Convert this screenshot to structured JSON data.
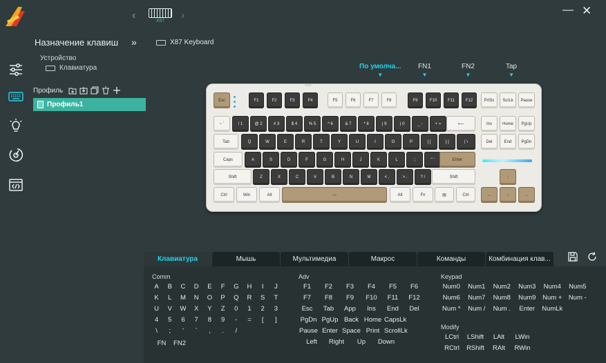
{
  "sidebar": {
    "title": "Назначение клавиш",
    "device_label": "Устройство",
    "device_item": "Клавиатура",
    "profile_label": "Профиль",
    "profile_item": "Профиль1"
  },
  "header": {
    "device_caption": "X87",
    "device_name": "X87 Keyboard"
  },
  "layers": [
    "По умолча...",
    "FN1",
    "FN2",
    "Tap"
  ],
  "colors": {
    "accent": "#3bb3a0",
    "highlight": "#22d3f0",
    "background": "#2f3b3c"
  },
  "keys": {
    "esc": "Esc",
    "f1": "F1",
    "f2": "F2",
    "f3": "F3",
    "f4": "F4",
    "f5": "F5",
    "f6": "F6",
    "f7": "F7",
    "f8": "F8",
    "f9": "F9",
    "f10": "F10",
    "f11": "F11",
    "f12": "F12",
    "prtsc": "PrtSc",
    "scrlk": "ScrLk",
    "pause": "Pause",
    "grave": "~ `",
    "n1": "! 1",
    "n2": "@ 2",
    "n3": "# 3",
    "n4": "$ 4",
    "n5": "% 5",
    "n6": "^ 6",
    "n7": "& 7",
    "n8": "* 8",
    "n9": "( 9",
    "n0": ") 0",
    "minus": "_ -",
    "equal": "+ =",
    "backspace": "⟵",
    "ins": "Ins",
    "home": "Home",
    "pgup": "PgUp",
    "tab": "Tab",
    "q": "Q",
    "w": "W",
    "e": "E",
    "r": "R",
    "t": "T",
    "y": "Y",
    "u": "U",
    "i": "I",
    "o": "O",
    "p": "P",
    "lbr": "{ [",
    "rbr": "} ]",
    "bslash": "| \\",
    "del": "Del",
    "end": "End",
    "pgdn": "PgDn",
    "caps": "Caps",
    "a": "A",
    "s": "S",
    "d": "D",
    "f": "F",
    "g": "G",
    "h": "H",
    "j": "J",
    "k": "K",
    "l": "L",
    "semi": ": ;",
    "quote": "\" '",
    "enter": "Enter",
    "lshift": "Shift",
    "z": "Z",
    "x": "X",
    "c": "C",
    "v": "V",
    "b": "B",
    "n": "N",
    "m": "M",
    "comma": "< ,",
    "period": "> .",
    "slash": "? /",
    "rshift": "Shift",
    "up": "↑",
    "lctrl": "Ctrl",
    "win": "Win",
    "lalt": "Alt",
    "space": "⎯⎯",
    "ralt": "Alt",
    "fn": "Fn",
    "menu": "▤",
    "rctrl": "Ctrl",
    "left": "←",
    "down": "↓",
    "right": "→"
  },
  "tabs": [
    "Клавиатура",
    "Мышь",
    "Мультимедиа",
    "Макрос",
    "Команды",
    "Комбинация клав..."
  ],
  "groups": {
    "comm_title": "Comm",
    "comm_rows": [
      [
        "A",
        "B",
        "C",
        "D",
        "E",
        "F",
        "G",
        "H",
        "I",
        "J"
      ],
      [
        "K",
        "L",
        "M",
        "N",
        "O",
        "P",
        "Q",
        "R",
        "S",
        "T"
      ],
      [
        "U",
        "V",
        "W",
        "X",
        "Y",
        "Z",
        "0",
        "1",
        "2",
        "3"
      ],
      [
        "4",
        "5",
        "6",
        "7",
        "8",
        "9",
        "-",
        "=",
        "[",
        "]"
      ],
      [
        "\\",
        ";",
        "'",
        "`",
        ",",
        ".",
        "/"
      ],
      [
        "FN",
        "FN2"
      ]
    ],
    "adv_title": "Adv",
    "adv_rows": [
      [
        "F1",
        "F2",
        "F3",
        "F4",
        "F5",
        "F6"
      ],
      [
        "F7",
        "F8",
        "F9",
        "F10",
        "F11",
        "F12"
      ],
      [
        "Esc",
        "Tab",
        "App",
        "Ins",
        "End",
        "Del"
      ],
      [
        "PgDn",
        "PgUp",
        "Back",
        "Home",
        "CapsLk"
      ],
      [
        "Pause",
        "Enter",
        "Space",
        "Print",
        "ScrollLk"
      ],
      [
        "Left",
        "Right",
        "Up",
        "Down"
      ]
    ],
    "keypad_title": "Keypad",
    "keypad_rows": [
      [
        "Num0",
        "Num1",
        "Num2",
        "Num3",
        "Num4",
        "Num5"
      ],
      [
        "Num6",
        "Num7",
        "Num8",
        "Num9",
        "Num +",
        "Num -"
      ],
      [
        "Num *",
        "Num /",
        "Num .",
        "Enter",
        "NumLk"
      ]
    ],
    "modify_title": "Modify",
    "modify_rows": [
      [
        "LCtrl",
        "LShift",
        "LAlt",
        "LWin"
      ],
      [
        "RCtrl",
        "RShift",
        "RAlt",
        "RWin"
      ]
    ]
  }
}
